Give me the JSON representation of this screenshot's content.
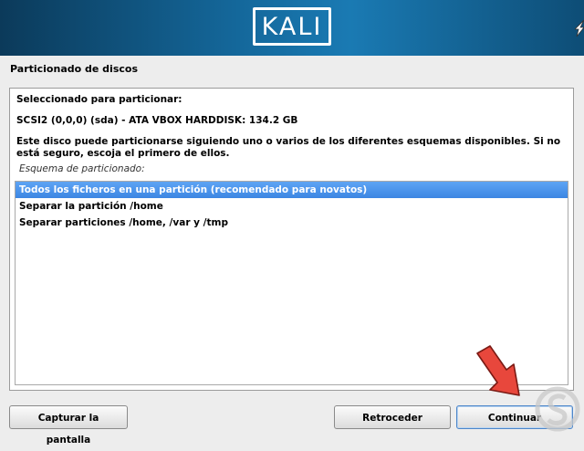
{
  "banner": {
    "logo_text": "KALI"
  },
  "page": {
    "title": "Particionado de discos"
  },
  "content": {
    "selected_label": "Seleccionado para particionar:",
    "disk_label": "SCSI2 (0,0,0) (sda) - ATA VBOX HARDDISK: 134.2 GB",
    "description": "Este disco puede particionarse siguiendo uno o varios de los diferentes esquemas disponibles. Si no está seguro, escoja el primero de ellos.",
    "scheme_label": "Esquema de particionado:",
    "options": [
      "Todos los ficheros en una partición (recomendado para novatos)",
      "Separar la partición /home",
      "Separar particiones /home, /var y /tmp"
    ],
    "selected_index": 0
  },
  "buttons": {
    "screenshot": "Capturar la pantalla",
    "back": "Retroceder",
    "continue": "Continuar"
  },
  "colors": {
    "banner": "#14679a",
    "selection": "#4a90e8",
    "arrow": "#e8473c"
  }
}
